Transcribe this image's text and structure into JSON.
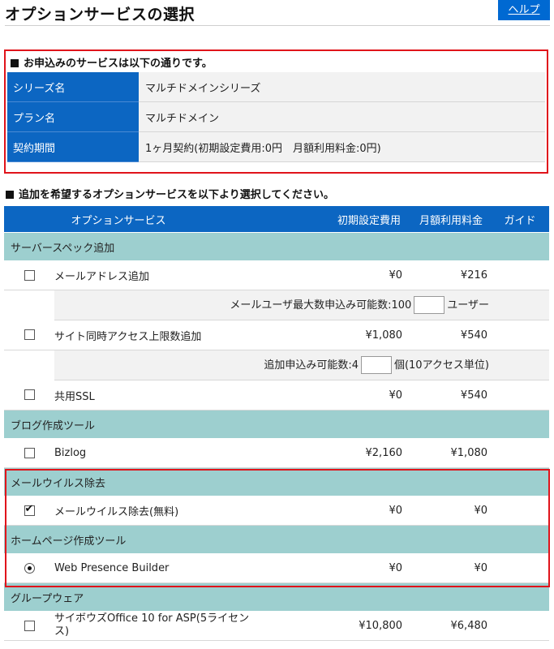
{
  "header": {
    "title": "オプションサービスの選択",
    "help_label": "ヘルプ"
  },
  "summary": {
    "title": "お申込みのサービスは以下の通りです。",
    "rows": [
      {
        "label": "シリーズ名",
        "value": "マルチドメインシリーズ"
      },
      {
        "label": "プラン名",
        "value": "マルチドメイン"
      },
      {
        "label": "契約期間",
        "value": "1ヶ月契約(初期設定費用:0円　月額利用料金:0円)"
      }
    ]
  },
  "options": {
    "title": "追加を希望するオプションサービスを以下より選択してください。",
    "columns": {
      "service": "オプションサービス",
      "initial_fee": "初期設定費用",
      "monthly_fee": "月額利用料金",
      "guide": "ガイド"
    },
    "categories": [
      {
        "name": "サーバースペック追加",
        "items": [
          {
            "name": "メールアドレス追加",
            "initial": "¥0",
            "monthly": "¥216",
            "checked": false,
            "sub": {
              "label": "メールユーザ最大数申込み可能数:100",
              "unit": "ユーザー",
              "value": ""
            }
          },
          {
            "name": "サイト同時アクセス上限数追加",
            "initial": "¥1,080",
            "monthly": "¥540",
            "checked": false,
            "sub": {
              "label": "追加申込み可能数:4",
              "unit": "個(10アクセス単位)",
              "value": ""
            }
          },
          {
            "name": "共用SSL",
            "initial": "¥0",
            "monthly": "¥540",
            "checked": false
          }
        ]
      },
      {
        "name": "ブログ作成ツール",
        "items": [
          {
            "name": "Bizlog",
            "initial": "¥2,160",
            "monthly": "¥1,080",
            "checked": false
          }
        ]
      },
      {
        "name": "メールウイルス除去",
        "items": [
          {
            "name": "メールウイルス除去(無料)",
            "initial": "¥0",
            "monthly": "¥0",
            "checked": true
          }
        ]
      },
      {
        "name": "ホームページ作成ツール",
        "items": [
          {
            "name": "Web Presence Builder",
            "initial": "¥0",
            "monthly": "¥0",
            "checked": true,
            "control": "radio"
          }
        ]
      },
      {
        "name": "グループウェア",
        "items": [
          {
            "name": "サイボウズOffice 10 for ASP(5ライセンス)",
            "initial": "¥10,800",
            "monthly": "¥6,480",
            "checked": false
          }
        ]
      }
    ]
  }
}
